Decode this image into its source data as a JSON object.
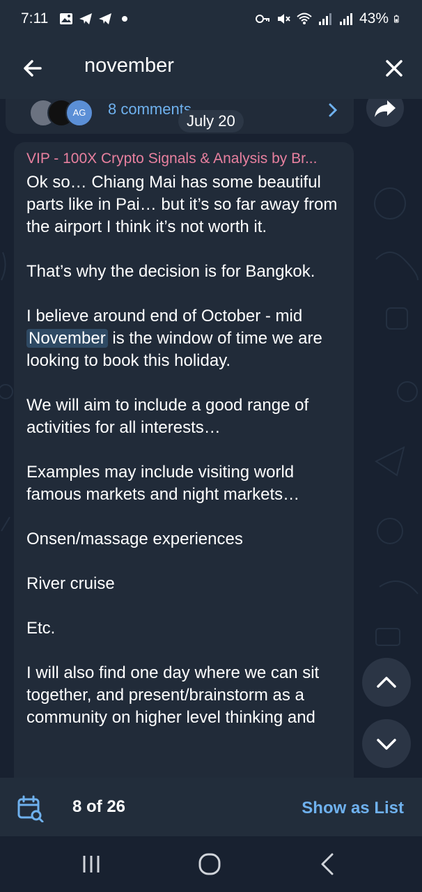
{
  "status_bar": {
    "time": "7:11",
    "battery": "43%",
    "left_icons": [
      "gallery-icon",
      "telegram-icon",
      "telegram-icon",
      "dot-icon"
    ],
    "right_icons": [
      "key-icon",
      "mute-icon",
      "wifi-icon",
      "signal-icon",
      "signal-icon",
      "battery-icon"
    ]
  },
  "search": {
    "query": "november"
  },
  "prev_post": {
    "comments_label": "8 comments",
    "avatar_badge": "AG",
    "date_pill": "July 20"
  },
  "message": {
    "author": "VIP - 100X Crypto Signals & Analysis by Br...",
    "paragraphs": {
      "p1": "Ok so… Chiang Mai has some beautiful parts like in Pai… but it’s so far away from the airport I think it’s not worth it.",
      "p2": "That’s why the decision is for Bangkok.",
      "p3_before": "I believe around end of October - mid ",
      "p3_highlight": "November",
      "p3_after": " is the window of time we are looking to book this holiday.",
      "p4": "We will aim to include a good range of activities for all interests…",
      "p5": "Examples may include visiting world famous markets and night markets…",
      "p6": "Onsen/massage experiences",
      "p7": "River cruise",
      "p8": "Etc.",
      "p9": "I will also find one day where we can sit together, and present/brainstorm as a community on higher level thinking and"
    }
  },
  "results_bar": {
    "count": "8 of 26",
    "show_as_list": "Show as List"
  },
  "colors": {
    "accent": "#6fb1ee",
    "author": "#e8809f",
    "bubble": "#212b39",
    "header": "#222d3b",
    "highlight": "#2f4a64"
  }
}
